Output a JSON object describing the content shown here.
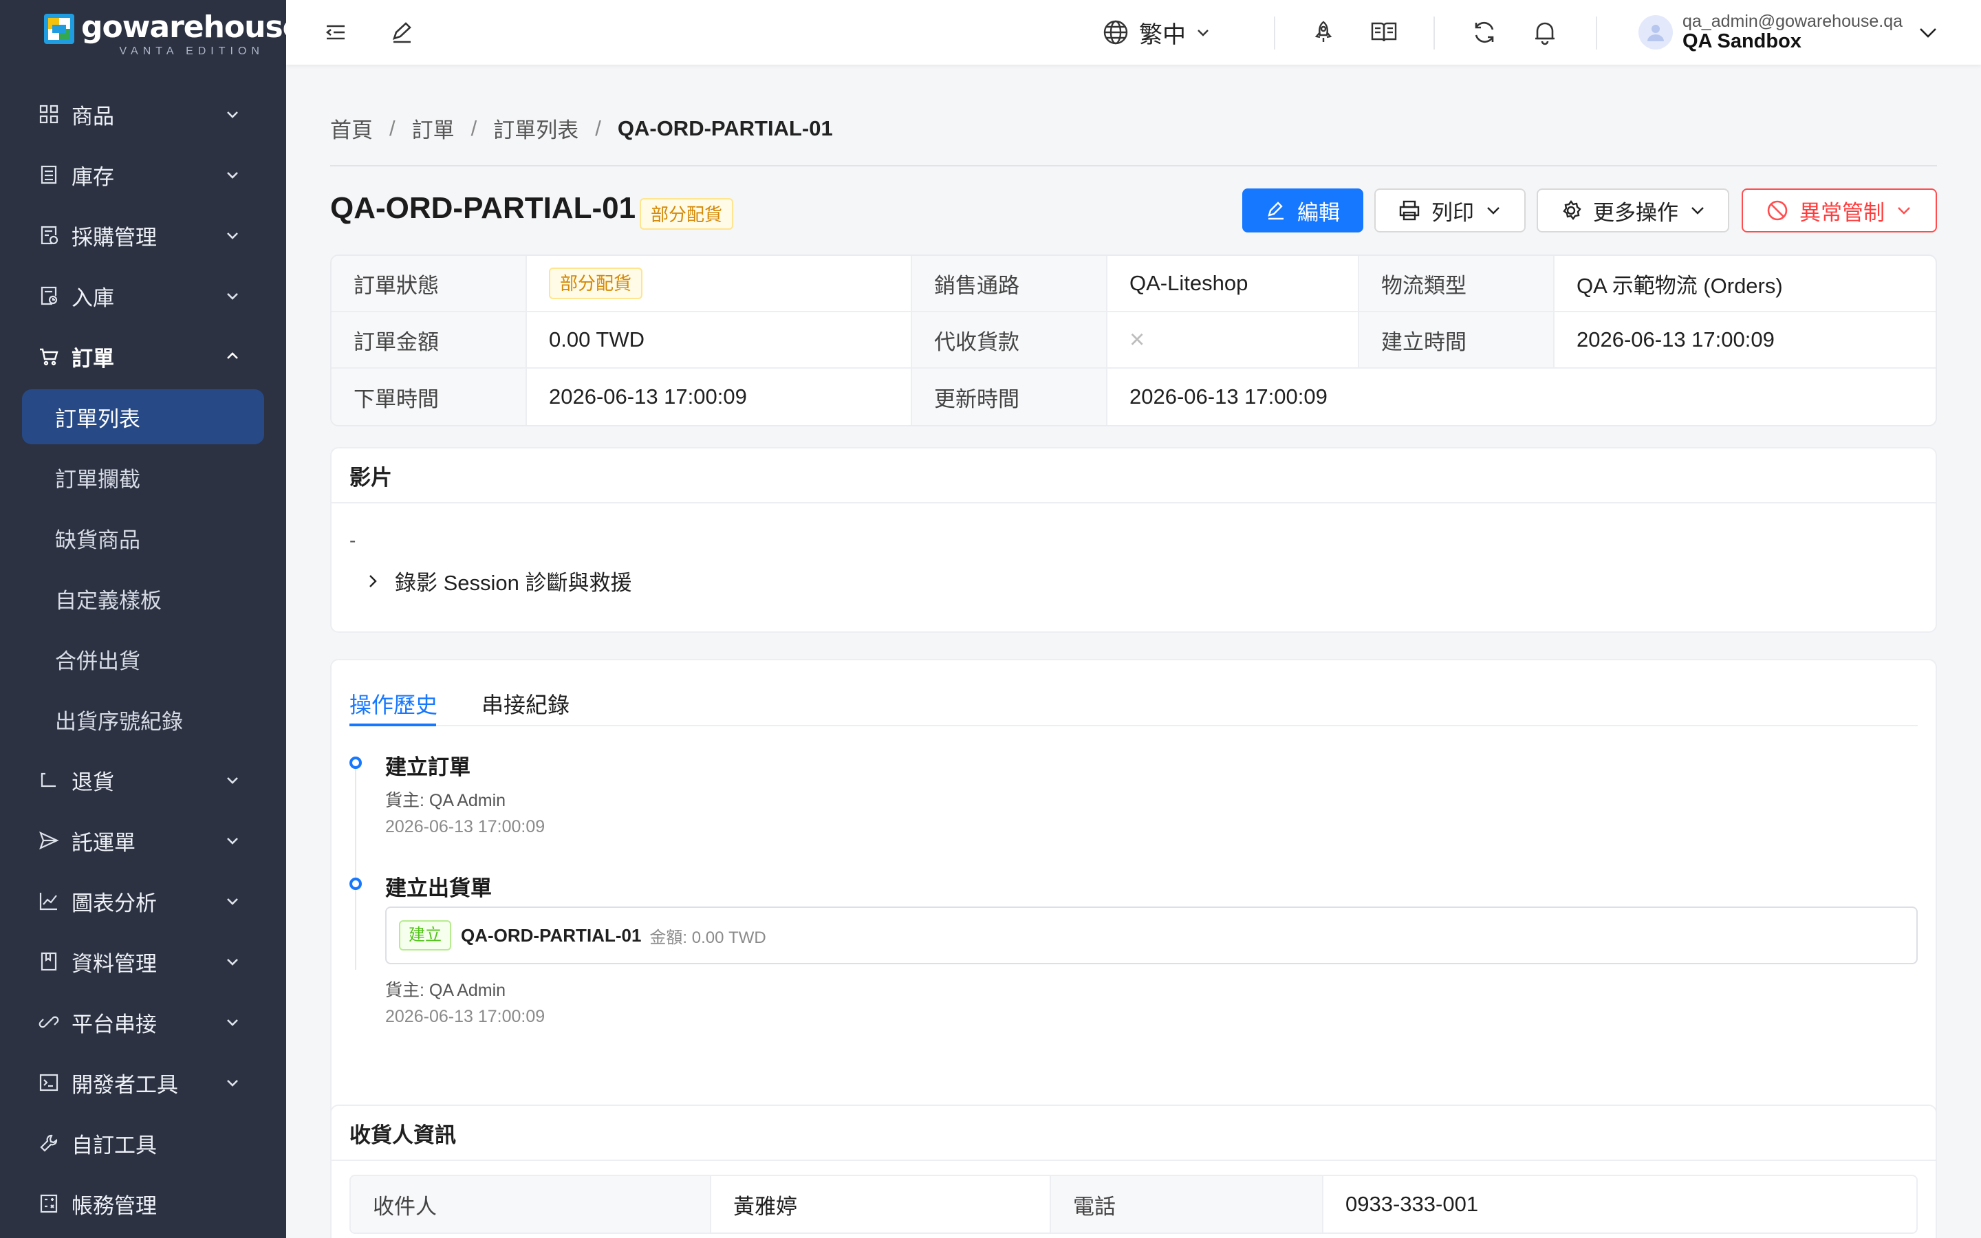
{
  "brand": {
    "name": "gowarehouse",
    "edition": "VANTA EDITION"
  },
  "sidebar": {
    "items": [
      {
        "label": "商品",
        "icon": "grid-icon"
      },
      {
        "label": "庫存",
        "icon": "inventory-icon"
      },
      {
        "label": "採購管理",
        "icon": "purchase-icon"
      },
      {
        "label": "入庫",
        "icon": "inbound-icon"
      },
      {
        "label": "訂單",
        "icon": "cart-icon"
      },
      {
        "label": "退貨",
        "icon": "return-icon"
      },
      {
        "label": "託運單",
        "icon": "send-icon"
      },
      {
        "label": "圖表分析",
        "icon": "chart-icon"
      },
      {
        "label": "資料管理",
        "icon": "book-icon"
      },
      {
        "label": "平台串接",
        "icon": "link-icon"
      },
      {
        "label": "開發者工具",
        "icon": "terminal-icon"
      },
      {
        "label": "自訂工具",
        "icon": "tool-icon"
      },
      {
        "label": "帳務管理",
        "icon": "calculator-icon"
      }
    ],
    "order_sub": [
      "訂單列表",
      "訂單攔截",
      "缺貨商品",
      "自定義樣板",
      "合併出貨",
      "出貨序號紀錄"
    ]
  },
  "topbar": {
    "language": "繁中",
    "user_email": "qa_admin@gowarehouse.qa",
    "tenant": "QA Sandbox"
  },
  "breadcrumb": [
    "首頁",
    "訂單",
    "訂單列表",
    "QA-ORD-PARTIAL-01"
  ],
  "page": {
    "title": "QA-ORD-PARTIAL-01",
    "status_tag": "部分配貨",
    "buttons": {
      "edit": "編輯",
      "print": "列印",
      "more": "更多操作",
      "exception": "異常管制"
    }
  },
  "info": {
    "rows": [
      [
        {
          "label": "訂單狀態",
          "value": "部分配貨",
          "type": "tag"
        },
        {
          "label": "銷售通路",
          "value": "QA-Liteshop"
        },
        {
          "label": "物流類型",
          "value": "QA 示範物流 (Orders)"
        }
      ],
      [
        {
          "label": "訂單金額",
          "value": "0.00 TWD"
        },
        {
          "label": "代收貨款",
          "value": "×",
          "type": "cross"
        },
        {
          "label": "建立時間",
          "value": "2026-06-13 17:00:09"
        }
      ],
      [
        {
          "label": "下單時間",
          "value": "2026-06-13 17:00:09"
        },
        {
          "label": "更新時間",
          "value": "2026-06-13 17:00:09"
        }
      ]
    ]
  },
  "video": {
    "title": "影片",
    "empty": "-",
    "collapse_label": "錄影 Session 診斷與救援"
  },
  "tabs": {
    "items": [
      "操作歷史",
      "串接紀錄"
    ],
    "active": 0
  },
  "timeline": [
    {
      "title": "建立訂單",
      "owner": "貨主: QA Admin",
      "time": "2026-06-13 17:00:09"
    },
    {
      "title": "建立出貨單",
      "tag": "建立",
      "shipment_no": "QA-ORD-PARTIAL-01",
      "amount": "金額: 0.00 TWD",
      "owner": "貨主: QA Admin",
      "time": "2026-06-13 17:00:09"
    }
  ],
  "receiver": {
    "title": "收貨人資訊",
    "name_label": "收件人",
    "name": "黃雅婷",
    "phone_label": "電話",
    "phone": "0933-333-001"
  },
  "colors": {
    "sidebar_bg": "#2c3242",
    "active_item": "#274a86",
    "primary": "#1677ff",
    "danger": "#ff4d4f",
    "warning_tag": "#d48806",
    "success_tag": "#52c41a"
  }
}
